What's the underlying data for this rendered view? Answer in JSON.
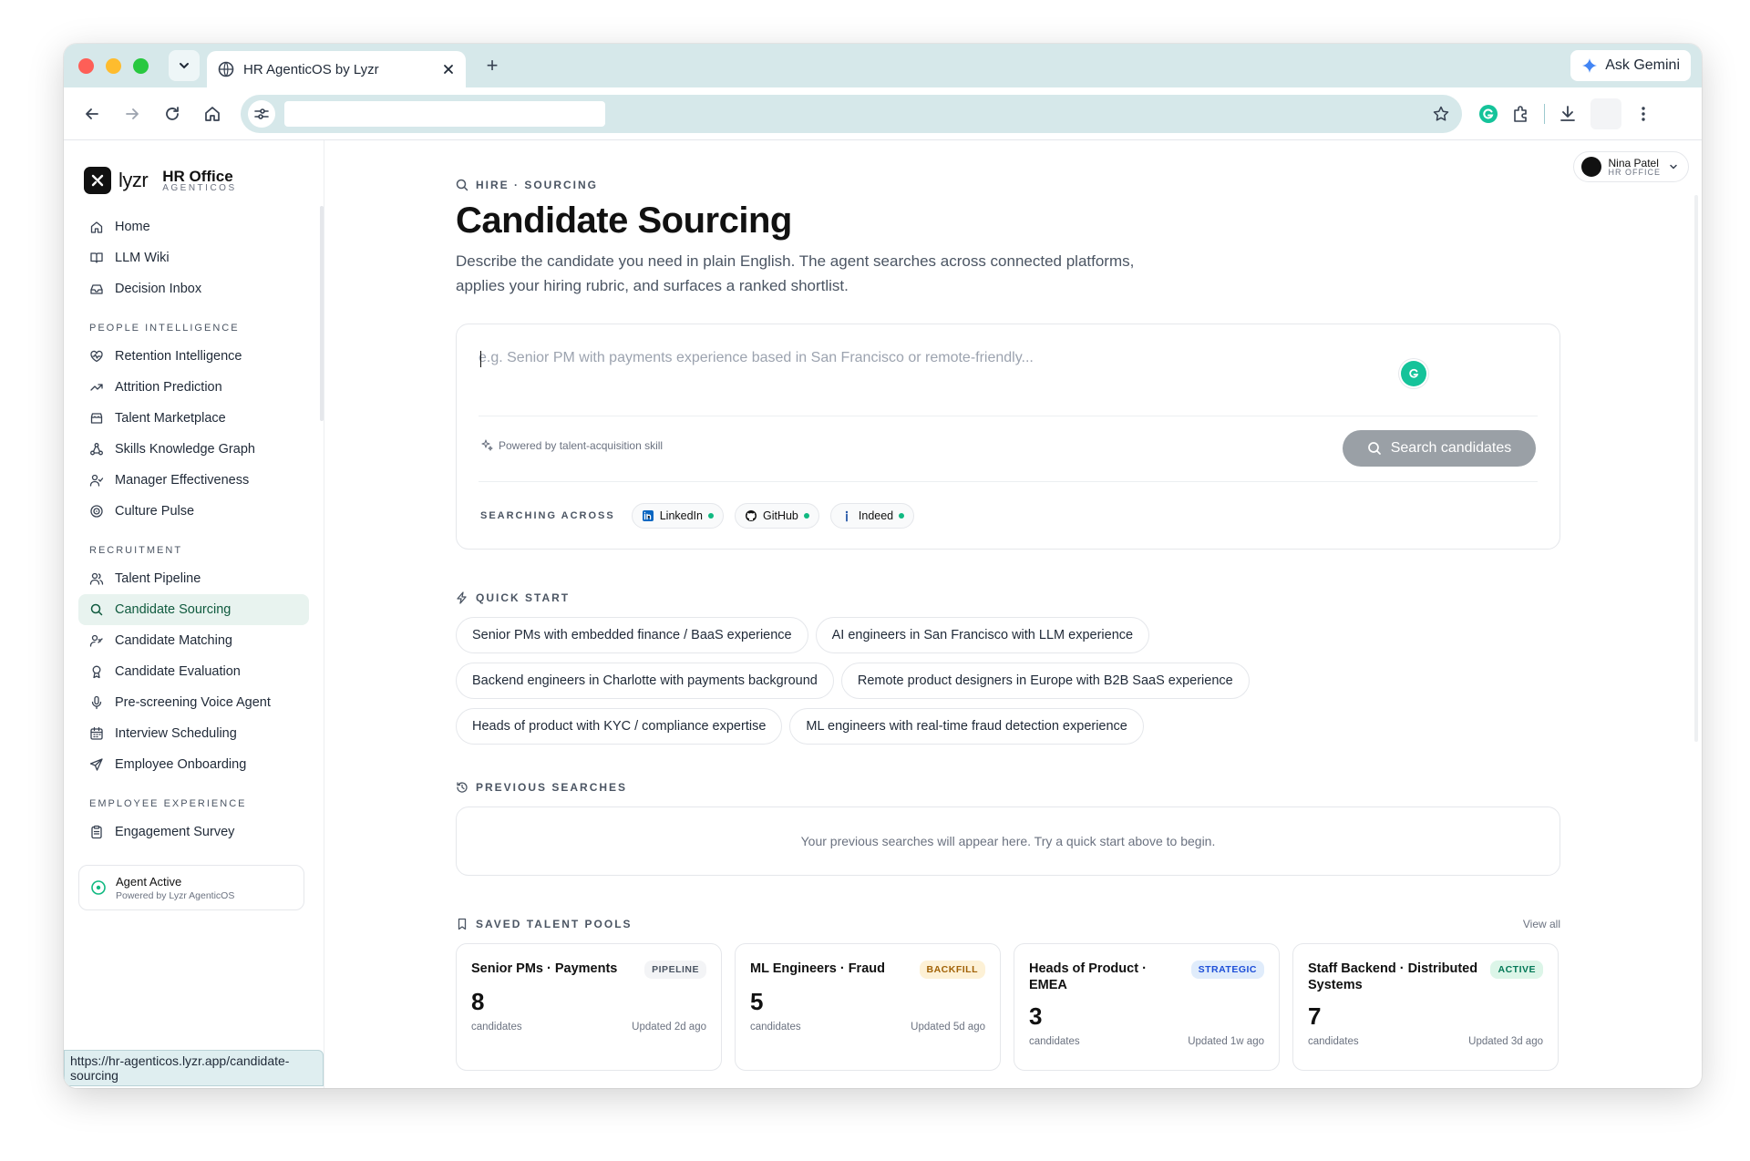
{
  "browser": {
    "tab_title": "HR AgenticOS by Lyzr",
    "ask_gemini": "Ask Gemini",
    "status_url": "https://hr-agenticos.lyzr.app/candidate-sourcing"
  },
  "brand": {
    "word": "lyzr",
    "title": "HR Office",
    "subtitle": "AGENTICOS"
  },
  "user": {
    "name": "Nina Patel",
    "role": "HR OFFICE"
  },
  "sidebar": {
    "top": [
      {
        "label": "Home",
        "icon": "home-icon"
      },
      {
        "label": "LLM Wiki",
        "icon": "book-icon"
      },
      {
        "label": "Decision Inbox",
        "icon": "inbox-icon"
      }
    ],
    "sections": [
      {
        "title": "PEOPLE INTELLIGENCE",
        "items": [
          {
            "label": "Retention Intelligence",
            "icon": "heart-pulse-icon"
          },
          {
            "label": "Attrition Prediction",
            "icon": "trend-icon"
          },
          {
            "label": "Talent Marketplace",
            "icon": "store-icon"
          },
          {
            "label": "Skills Knowledge Graph",
            "icon": "graph-icon"
          },
          {
            "label": "Manager Effectiveness",
            "icon": "user-check-icon"
          },
          {
            "label": "Culture Pulse",
            "icon": "pulse-icon"
          }
        ]
      },
      {
        "title": "RECRUITMENT",
        "items": [
          {
            "label": "Talent Pipeline",
            "icon": "users-icon"
          },
          {
            "label": "Candidate Sourcing",
            "icon": "search-icon",
            "active": true
          },
          {
            "label": "Candidate Matching",
            "icon": "user-match-icon"
          },
          {
            "label": "Candidate Evaluation",
            "icon": "award-icon"
          },
          {
            "label": "Pre-screening Voice Agent",
            "icon": "mic-icon"
          },
          {
            "label": "Interview Scheduling",
            "icon": "calendar-icon"
          },
          {
            "label": "Employee Onboarding",
            "icon": "send-icon"
          }
        ]
      },
      {
        "title": "EMPLOYEE EXPERIENCE",
        "items": [
          {
            "label": "Engagement Survey",
            "icon": "clipboard-icon"
          }
        ]
      }
    ],
    "agent": {
      "title": "Agent Active",
      "subtitle": "Powered by Lyzr AgenticOS"
    }
  },
  "page": {
    "breadcrumb": "HIRE · SOURCING",
    "title": "Candidate Sourcing",
    "description": "Describe the candidate you need in plain English. The agent searches across connected platforms, applies your hiring rubric, and surfaces a ranked shortlist."
  },
  "search": {
    "placeholder": "e.g. Senior PM with payments experience based in San Francisco or remote-friendly...",
    "powered_by": "Powered by talent-acquisition skill",
    "button": "Search candidates",
    "searching_across": "SEARCHING ACROSS",
    "platforms": [
      {
        "name": "LinkedIn",
        "icon": "linkedin-icon"
      },
      {
        "name": "GitHub",
        "icon": "github-icon"
      },
      {
        "name": "Indeed",
        "icon": "indeed-icon"
      }
    ]
  },
  "quick_start": {
    "title": "QUICK START",
    "items": [
      "Senior PMs with embedded finance / BaaS experience",
      "AI engineers in San Francisco with LLM experience",
      "Backend engineers in Charlotte with payments background",
      "Remote product designers in Europe with B2B SaaS experience",
      "Heads of product with KYC / compliance expertise",
      "ML engineers with real-time fraud detection experience"
    ]
  },
  "previous": {
    "title": "PREVIOUS SEARCHES",
    "empty": "Your previous searches will appear here. Try a quick start above to begin."
  },
  "pools": {
    "title": "SAVED TALENT POOLS",
    "view_all": "View all",
    "items": [
      {
        "name": "Senior PMs · Payments",
        "badge": "PIPELINE",
        "badge_bg": "#f3f4f6",
        "badge_fg": "#4b5563",
        "count": "8",
        "unit": "candidates",
        "updated": "Updated 2d ago"
      },
      {
        "name": "ML Engineers · Fraud",
        "badge": "BACKFILL",
        "badge_bg": "#fdf1d6",
        "badge_fg": "#a16207",
        "count": "5",
        "unit": "candidates",
        "updated": "Updated 5d ago"
      },
      {
        "name": "Heads of Product · EMEA",
        "badge": "STRATEGIC",
        "badge_bg": "#e0ecfb",
        "badge_fg": "#1d4ed8",
        "count": "3",
        "unit": "candidates",
        "updated": "Updated 1w ago"
      },
      {
        "name": "Staff Backend · Distributed Systems",
        "badge": "ACTIVE",
        "badge_bg": "#dcf5e8",
        "badge_fg": "#047857",
        "count": "7",
        "unit": "candidates",
        "updated": "Updated 3d ago"
      }
    ]
  }
}
